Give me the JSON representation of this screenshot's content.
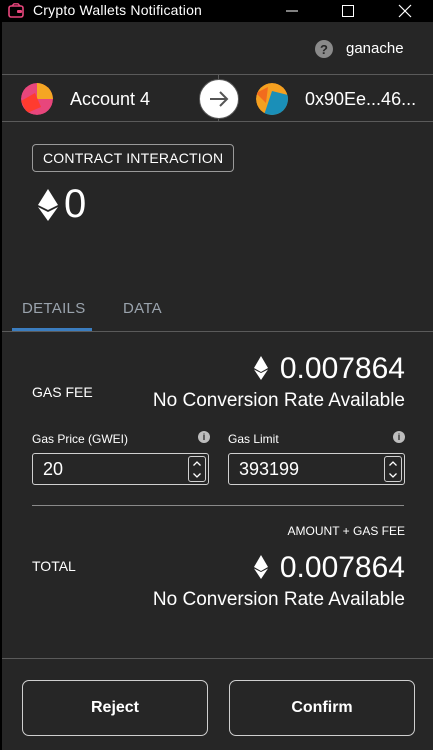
{
  "window": {
    "title": "Crypto Wallets Notification",
    "minimize_glyph": "—",
    "maximize_glyph": "☐",
    "close_glyph": "✕"
  },
  "network": {
    "help_icon": "?",
    "name": "ganache"
  },
  "sender": {
    "from_name": "Account 4",
    "to_address": "0x90Ee...46..."
  },
  "transaction": {
    "type_badge": "CONTRACT INTERACTION",
    "amount": "0"
  },
  "tabs": [
    {
      "label": "DETAILS",
      "active": true
    },
    {
      "label": "DATA",
      "active": false
    }
  ],
  "details": {
    "gas_fee_label": "GAS FEE",
    "gas_fee_value": "0.007864",
    "gas_fee_conversion": "No Conversion Rate Available",
    "gas_price_label": "Gas Price (GWEI)",
    "gas_price_value": "20",
    "gas_limit_label": "Gas Limit",
    "gas_limit_value": "393199",
    "amount_plus_gas_label": "AMOUNT + GAS FEE",
    "total_label": "TOTAL",
    "total_value": "0.007864",
    "total_conversion": "No Conversion Rate Available"
  },
  "actions": {
    "reject_label": "Reject",
    "confirm_label": "Confirm"
  },
  "colors": {
    "background": "#262626",
    "tab_accent": "#3b7dbf",
    "border": "#5a5a5a"
  }
}
